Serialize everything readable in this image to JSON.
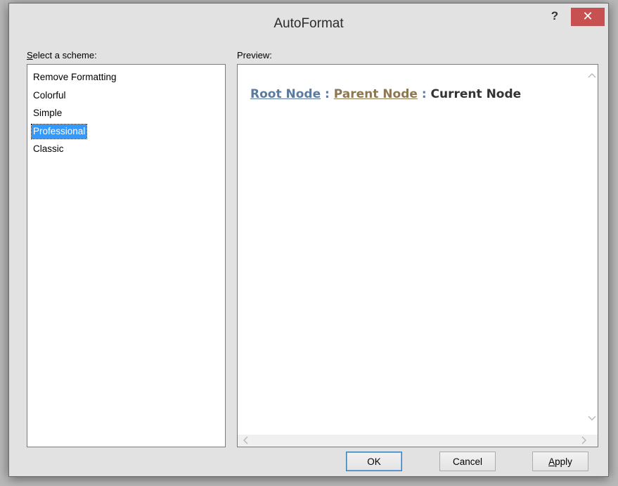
{
  "window": {
    "title": "AutoFormat",
    "help_label": "?",
    "close_label": "✕"
  },
  "schemes": {
    "label_accel": "S",
    "label_rest": "elect a scheme:",
    "items": [
      {
        "label": "Remove Formatting",
        "selected": false
      },
      {
        "label": "Colorful",
        "selected": false
      },
      {
        "label": "Simple",
        "selected": false
      },
      {
        "label": "Professional",
        "selected": true
      },
      {
        "label": "Classic",
        "selected": false
      }
    ]
  },
  "preview": {
    "label": "Preview:",
    "root": "Root Node",
    "separator": " : ",
    "parent": "Parent Node",
    "current": "Current Node",
    "colors": {
      "root": "#5d7b9d",
      "parent": "#8c7752",
      "current": "#333333"
    }
  },
  "buttons": {
    "ok": "OK",
    "cancel": "Cancel",
    "apply_accel": "A",
    "apply_rest": "pply"
  },
  "icons": {
    "close": "close-icon",
    "help": "help-icon",
    "scroll_up": "chevron-up-icon",
    "scroll_down": "chevron-down-icon",
    "scroll_left": "chevron-left-icon",
    "scroll_right": "chevron-right-icon"
  }
}
